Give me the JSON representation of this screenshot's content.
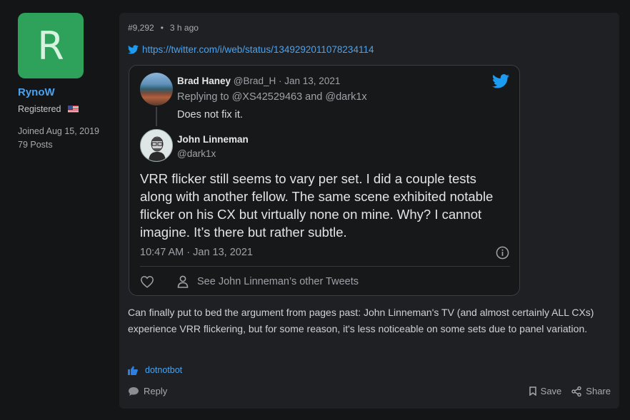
{
  "user": {
    "avatar_letter": "R",
    "name": "RynoW",
    "title": "Registered",
    "joined": "Joined Aug 15, 2019",
    "posts": "79 Posts",
    "flag": "us-flag-icon"
  },
  "post": {
    "number": "#9,292",
    "separator": "•",
    "time": "3 h ago",
    "link": "https://twitter.com/i/web/status/1349292011078234114",
    "body": "Can finally put to bed the argument from pages past: John Linneman's TV (and almost certainly ALL CXs) experience VRR flickering, but for some reason, it's less noticeable on some sets due to panel variation.",
    "reaction_user": "dotnotbot",
    "reply_label": "Reply",
    "save_label": "Save",
    "share_label": "Share"
  },
  "tweet": {
    "reply_author": {
      "name": "Brad Haney",
      "handle": "@Brad_H · Jan 13, 2021"
    },
    "replying_to": "Replying to @XS42529463 and @dark1x",
    "reply_text": "Does not fix it.",
    "author": {
      "name": "John Linneman",
      "handle": "@dark1x"
    },
    "text": "VRR flicker still seems to vary per set. I did a couple tests along with another fellow. The same scene exhibited notable flicker on his CX but virtually none on mine. Why? I cannot imagine. It’s there but rather subtle.",
    "timestamp": "10:47 AM · Jan 13, 2021",
    "other_tweets": "See John Linneman’s other Tweets"
  },
  "colors": {
    "accent": "#4aa3f0",
    "avatar_bg": "#2ea25a",
    "twitter_blue": "#1d9bf0",
    "page_bg": "#141517",
    "panel_bg": "#1e2023"
  }
}
